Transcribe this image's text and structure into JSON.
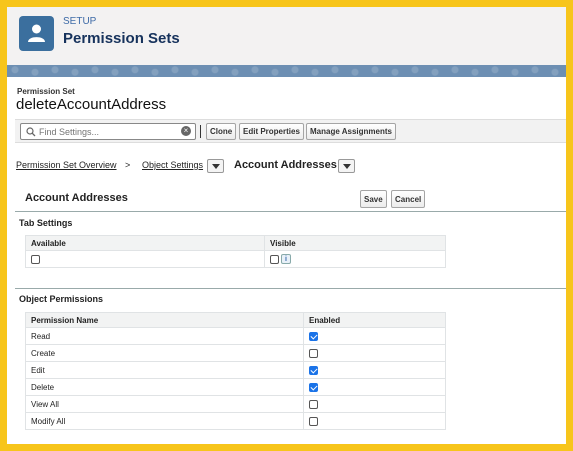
{
  "header": {
    "section_label": "SETUP",
    "title": "Permission Sets"
  },
  "permission_set": {
    "small_label": "Permission Set",
    "name": "deleteAccountAddress"
  },
  "toolbar": {
    "search_placeholder": "Find Settings...",
    "clone_label": "Clone",
    "edit_properties_label": "Edit Properties",
    "manage_assignments_label": "Manage Assignments"
  },
  "breadcrumb": {
    "overview": "Permission Set Overview",
    "separator": ">",
    "object_settings": "Object Settings",
    "current": "Account Addresses"
  },
  "edit_panel": {
    "title": "Account Addresses",
    "save_label": "Save",
    "cancel_label": "Cancel"
  },
  "tab_settings": {
    "heading": "Tab Settings",
    "columns": [
      "Available",
      "Visible"
    ],
    "available_checked": false,
    "visible_checked": false,
    "info_icon": "info-icon"
  },
  "object_permissions": {
    "heading": "Object Permissions",
    "columns": [
      "Permission Name",
      "Enabled"
    ],
    "rows": [
      {
        "name": "Read",
        "enabled": true
      },
      {
        "name": "Create",
        "enabled": false
      },
      {
        "name": "Edit",
        "enabled": true
      },
      {
        "name": "Delete",
        "enabled": true
      },
      {
        "name": "View All",
        "enabled": false
      },
      {
        "name": "Modify All",
        "enabled": false
      }
    ]
  },
  "colors": {
    "frame_border": "#f7c51b",
    "setup_icon_bg": "#3b6f9e",
    "setup_label": "#3e6ba7",
    "checkbox_checked": "#1a73e8"
  }
}
